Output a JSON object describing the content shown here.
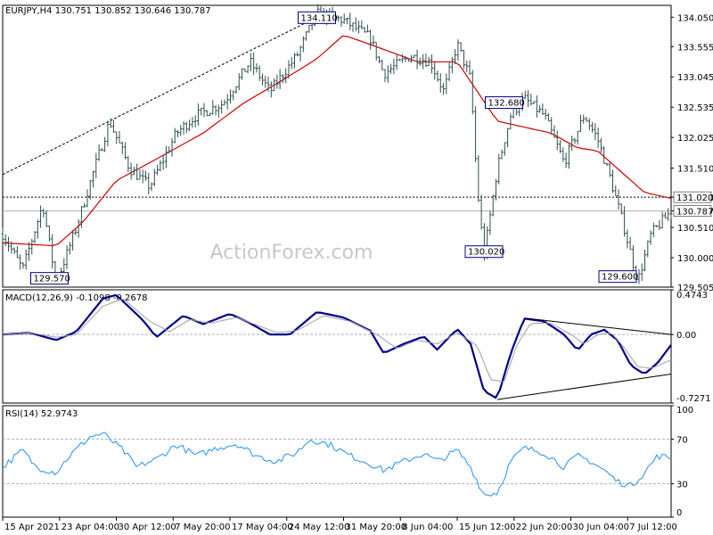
{
  "chart_data": [
    {
      "type": "ohlc",
      "symbol_line": "EURJPY,H4  130.751 130.852 130.646 130.787",
      "watermark": "ActionForex.com",
      "ylim": [
        129.505,
        134.25
      ],
      "y_ticks": [
        "134.050",
        "133.555",
        "133.045",
        "132.535",
        "132.025",
        "131.510",
        "131.020",
        "130.787",
        "130.510",
        "130.000",
        "129.505"
      ],
      "y_tick_values": [
        134.05,
        133.555,
        133.045,
        132.535,
        132.025,
        131.51,
        131.02,
        130.787,
        130.51,
        130.0,
        129.505
      ],
      "current_price": "130.787",
      "level_price": "131.020",
      "annotations": [
        {
          "label": "134.110",
          "value": 134.11,
          "anchor_x": 0.47
        },
        {
          "label": "132.680",
          "value": 132.68,
          "anchor_x": 0.75
        },
        {
          "label": "130.020",
          "value": 130.02,
          "anchor_x": 0.72
        },
        {
          "label": "129.570",
          "value": 129.57,
          "anchor_x": 0.07
        },
        {
          "label": "129.600",
          "value": 129.6,
          "anchor_x": 0.92
        }
      ],
      "price_key_points": [
        [
          0,
          130.4
        ],
        [
          0.03,
          129.8
        ],
        [
          0.06,
          130.9
        ],
        [
          0.08,
          129.57
        ],
        [
          0.11,
          130.5
        ],
        [
          0.14,
          131.6
        ],
        [
          0.16,
          132.3
        ],
        [
          0.19,
          131.5
        ],
        [
          0.22,
          131.2
        ],
        [
          0.26,
          132.1
        ],
        [
          0.29,
          132.4
        ],
        [
          0.33,
          132.6
        ],
        [
          0.37,
          133.3
        ],
        [
          0.4,
          132.8
        ],
        [
          0.44,
          133.4
        ],
        [
          0.47,
          134.11
        ],
        [
          0.51,
          134.0
        ],
        [
          0.55,
          133.7
        ],
        [
          0.57,
          133.1
        ],
        [
          0.61,
          133.4
        ],
        [
          0.64,
          133.3
        ],
        [
          0.66,
          132.8
        ],
        [
          0.68,
          133.6
        ],
        [
          0.7,
          133.0
        ],
        [
          0.71,
          131.2
        ],
        [
          0.72,
          130.02
        ],
        [
          0.74,
          131.5
        ],
        [
          0.76,
          132.4
        ],
        [
          0.78,
          132.68
        ],
        [
          0.81,
          132.4
        ],
        [
          0.84,
          131.6
        ],
        [
          0.87,
          132.4
        ],
        [
          0.89,
          132.0
        ],
        [
          0.91,
          131.3
        ],
        [
          0.93,
          130.5
        ],
        [
          0.95,
          129.6
        ],
        [
          0.97,
          130.4
        ],
        [
          1.0,
          130.787
        ]
      ],
      "ma_key_points": [
        [
          0,
          130.25
        ],
        [
          0.08,
          130.2
        ],
        [
          0.12,
          130.6
        ],
        [
          0.17,
          131.3
        ],
        [
          0.22,
          131.6
        ],
        [
          0.3,
          132.1
        ],
        [
          0.36,
          132.6
        ],
        [
          0.42,
          133.0
        ],
        [
          0.47,
          133.35
        ],
        [
          0.51,
          133.75
        ],
        [
          0.56,
          133.55
        ],
        [
          0.62,
          133.3
        ],
        [
          0.68,
          133.3
        ],
        [
          0.71,
          132.8
        ],
        [
          0.74,
          132.3
        ],
        [
          0.78,
          132.2
        ],
        [
          0.82,
          132.1
        ],
        [
          0.86,
          131.85
        ],
        [
          0.89,
          131.8
        ],
        [
          0.92,
          131.5
        ],
        [
          0.96,
          131.1
        ],
        [
          1.0,
          131.0
        ]
      ],
      "trendline": {
        "from": [
          0.0,
          131.4
        ],
        "to": [
          0.47,
          134.05
        ]
      }
    },
    {
      "type": "line",
      "title": "MACD(12,26,9) -0.1098 -0.2678",
      "ylim": [
        -0.7271,
        0.4743
      ],
      "y_ticks": [
        "0.4743",
        "0.00",
        "-0.7271"
      ],
      "y_tick_values": [
        0.4743,
        0.0,
        -0.7271
      ],
      "series": [
        {
          "name": "MACD",
          "color": "#00008b",
          "key_points": [
            [
              0,
              0.0
            ],
            [
              0.04,
              0.02
            ],
            [
              0.08,
              -0.06
            ],
            [
              0.11,
              0.03
            ],
            [
              0.15,
              0.38
            ],
            [
              0.17,
              0.42
            ],
            [
              0.21,
              0.15
            ],
            [
              0.23,
              -0.03
            ],
            [
              0.27,
              0.2
            ],
            [
              0.3,
              0.11
            ],
            [
              0.34,
              0.22
            ],
            [
              0.37,
              0.12
            ],
            [
              0.4,
              0.0
            ],
            [
              0.43,
              0.0
            ],
            [
              0.47,
              0.24
            ],
            [
              0.51,
              0.18
            ],
            [
              0.55,
              0.04
            ],
            [
              0.57,
              -0.2
            ],
            [
              0.6,
              -0.1
            ],
            [
              0.63,
              -0.02
            ],
            [
              0.65,
              -0.16
            ],
            [
              0.68,
              0.06
            ],
            [
              0.7,
              -0.1
            ],
            [
              0.72,
              -0.6
            ],
            [
              0.74,
              -0.68
            ],
            [
              0.76,
              -0.2
            ],
            [
              0.78,
              0.17
            ],
            [
              0.81,
              0.14
            ],
            [
              0.84,
              0.0
            ],
            [
              0.86,
              -0.17
            ],
            [
              0.88,
              0.0
            ],
            [
              0.9,
              0.05
            ],
            [
              0.92,
              -0.06
            ],
            [
              0.94,
              -0.33
            ],
            [
              0.96,
              -0.42
            ],
            [
              0.98,
              -0.3
            ],
            [
              1.0,
              -0.11
            ]
          ]
        },
        {
          "name": "Signal",
          "color": "#9e9ea8",
          "key_points": [
            [
              0,
              0.0
            ],
            [
              0.04,
              0.02
            ],
            [
              0.08,
              -0.03
            ],
            [
              0.11,
              0.0
            ],
            [
              0.15,
              0.3
            ],
            [
              0.18,
              0.38
            ],
            [
              0.22,
              0.14
            ],
            [
              0.25,
              0.03
            ],
            [
              0.28,
              0.16
            ],
            [
              0.31,
              0.12
            ],
            [
              0.35,
              0.18
            ],
            [
              0.38,
              0.1
            ],
            [
              0.41,
              0.02
            ],
            [
              0.44,
              0.04
            ],
            [
              0.48,
              0.2
            ],
            [
              0.52,
              0.14
            ],
            [
              0.56,
              0.0
            ],
            [
              0.59,
              -0.15
            ],
            [
              0.62,
              -0.06
            ],
            [
              0.65,
              -0.1
            ],
            [
              0.68,
              0.02
            ],
            [
              0.71,
              -0.12
            ],
            [
              0.73,
              -0.48
            ],
            [
              0.75,
              -0.5
            ],
            [
              0.77,
              -0.1
            ],
            [
              0.79,
              0.12
            ],
            [
              0.82,
              0.12
            ],
            [
              0.85,
              0.0
            ],
            [
              0.87,
              -0.1
            ],
            [
              0.89,
              0.0
            ],
            [
              0.91,
              0.02
            ],
            [
              0.93,
              -0.14
            ],
            [
              0.95,
              -0.34
            ],
            [
              0.97,
              -0.36
            ],
            [
              1.0,
              -0.27
            ]
          ]
        }
      ],
      "trendlines": [
        {
          "from": [
            0.785,
            0.17
          ],
          "to": [
            1.0,
            0.0
          ]
        },
        {
          "from": [
            0.74,
            -0.69
          ],
          "to": [
            1.0,
            -0.42
          ]
        }
      ]
    },
    {
      "type": "line",
      "title": "RSI(14) 52.9743",
      "ylim": [
        0,
        100
      ],
      "y_ticks": [
        "100",
        "70",
        "30",
        "0"
      ],
      "y_tick_values": [
        100,
        70,
        30,
        0
      ],
      "levels": [
        70,
        30
      ],
      "series": [
        {
          "name": "RSI",
          "color": "#1e90ff",
          "key_points": [
            [
              0,
              45
            ],
            [
              0.03,
              60
            ],
            [
              0.05,
              45
            ],
            [
              0.08,
              40
            ],
            [
              0.1,
              55
            ],
            [
              0.13,
              72
            ],
            [
              0.15,
              75
            ],
            [
              0.18,
              60
            ],
            [
              0.2,
              45
            ],
            [
              0.23,
              52
            ],
            [
              0.26,
              65
            ],
            [
              0.29,
              55
            ],
            [
              0.32,
              62
            ],
            [
              0.35,
              66
            ],
            [
              0.38,
              55
            ],
            [
              0.41,
              50
            ],
            [
              0.44,
              58
            ],
            [
              0.46,
              70
            ],
            [
              0.49,
              65
            ],
            [
              0.52,
              55
            ],
            [
              0.55,
              48
            ],
            [
              0.57,
              42
            ],
            [
              0.6,
              50
            ],
            [
              0.63,
              57
            ],
            [
              0.65,
              50
            ],
            [
              0.68,
              60
            ],
            [
              0.7,
              45
            ],
            [
              0.72,
              20
            ],
            [
              0.74,
              22
            ],
            [
              0.76,
              50
            ],
            [
              0.78,
              62
            ],
            [
              0.81,
              58
            ],
            [
              0.84,
              45
            ],
            [
              0.86,
              55
            ],
            [
              0.88,
              50
            ],
            [
              0.9,
              42
            ],
            [
              0.92,
              32
            ],
            [
              0.94,
              28
            ],
            [
              0.96,
              40
            ],
            [
              0.98,
              55
            ],
            [
              1.0,
              53
            ]
          ]
        }
      ]
    }
  ],
  "x_axis": {
    "labels": [
      "15 Apr 2021",
      "23 Apr 04:00",
      "30 Apr 12:00",
      "7 May 20:00",
      "17 May 04:00",
      "24 May 12:00",
      "31 May 20:00",
      "8 Jun 04:00",
      "15 Jun 12:00",
      "22 Jun 20:00",
      "30 Jun 04:00",
      "7 Jul 12:00"
    ],
    "positions": [
      0.0,
      0.085,
      0.17,
      0.255,
      0.34,
      0.425,
      0.51,
      0.595,
      0.68,
      0.765,
      0.85,
      0.935
    ]
  }
}
